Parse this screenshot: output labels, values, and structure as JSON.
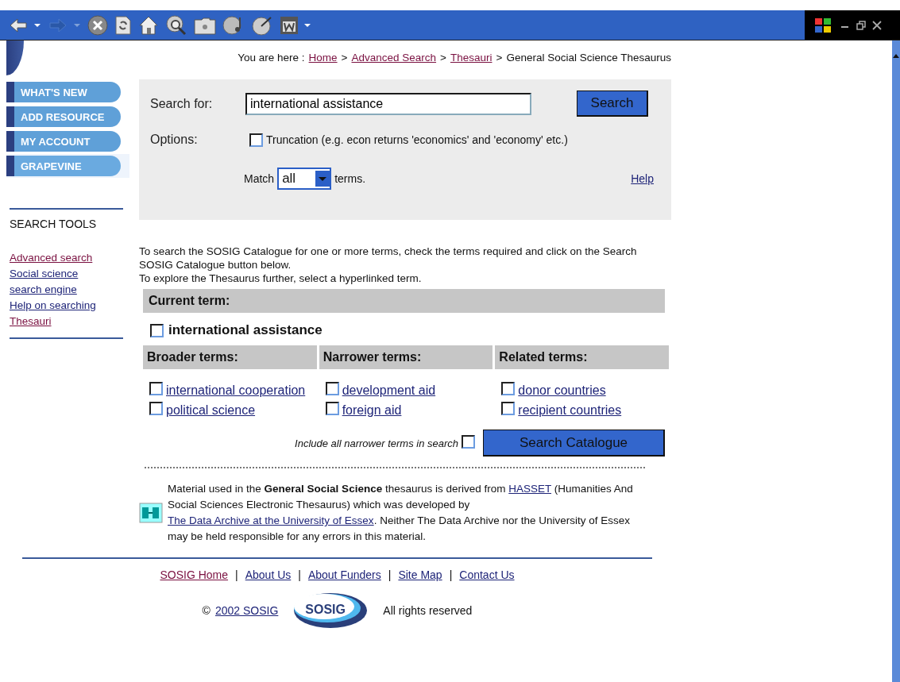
{
  "breadcrumb": {
    "label": "You are here :",
    "items": [
      {
        "kind": "link",
        "text": "Home",
        "visited": true
      },
      {
        "kind": "sep",
        "text": ">"
      },
      {
        "kind": "link",
        "text": "Advanced Search",
        "visited": true
      },
      {
        "kind": "sep",
        "text": ">"
      },
      {
        "kind": "link",
        "text": "Thesauri",
        "visited": true
      },
      {
        "kind": "sep",
        "text": ">"
      },
      {
        "kind": "text",
        "text": "General Social Science Thesaurus"
      }
    ]
  },
  "nav": [
    {
      "label": "WHAT'S NEW",
      "selected": false
    },
    {
      "label": "ADD RESOURCE",
      "selected": false
    },
    {
      "label": "MY ACCOUNT",
      "selected": false
    },
    {
      "label": "GRAPEVINE",
      "selected": true
    }
  ],
  "search_tools": {
    "heading": "SEARCH TOOLS",
    "links": [
      {
        "text": "Advanced search",
        "visited": true
      },
      {
        "text": "Social science search engine",
        "visited": false
      },
      {
        "text": "Help on searching",
        "visited": false
      },
      {
        "text": "Thesauri",
        "visited": true
      }
    ]
  },
  "search_form": {
    "search_label": "Search for:",
    "query": "international assistance",
    "search_button": "Search",
    "options_label": "Options:",
    "truncation": {
      "label": "Truncation (e.g. econ returns 'economics' and 'economy' etc.)",
      "checked": false
    },
    "match_label": "Match",
    "match_value": "all",
    "terms_label": "terms.",
    "help_link": "Help"
  },
  "instructions": [
    "To search the SOSIG Catalogue for one or more terms, check the terms required and click on the Search SOSIG Catalogue button below.",
    "To explore the Thesaurus further, select a hyperlinked term."
  ],
  "current_term": {
    "heading": "Current term:",
    "term": {
      "text": "international assistance",
      "checked": false
    }
  },
  "term_columns": [
    {
      "heading": "Broader terms:",
      "terms": [
        {
          "text": "international cooperation",
          "checked": false
        },
        {
          "text": "political science",
          "checked": false
        }
      ]
    },
    {
      "heading": "Narrower terms:",
      "terms": [
        {
          "text": "development aid",
          "checked": false
        },
        {
          "text": "foreign aid",
          "checked": false
        }
      ]
    },
    {
      "heading": "Related terms:",
      "terms": [
        {
          "text": "donor countries",
          "checked": false
        },
        {
          "text": "recipient countries",
          "checked": false
        }
      ]
    }
  ],
  "include_narrower": {
    "label": "Include all narrower terms in search",
    "checked": false
  },
  "search_catalogue_button": "Search Catalogue",
  "attribution": [
    {
      "kind": "text",
      "text": "Material used in the **General Social Science** thesaurus is derived from "
    },
    {
      "kind": "link",
      "text": "HASSET"
    },
    {
      "kind": "text",
      "text": " (Humanities And Social Sciences Electronic Thesaurus) which was developed by "
    },
    {
      "kind": "link",
      "text": "The Data Archive at the University of Essex"
    },
    {
      "kind": "text",
      "text": ". Neither The Data Archive nor the University of Essex may be held responsible for any errors in this material."
    }
  ],
  "footer_links": [
    {
      "kind": "link",
      "text": "SOSIG Home",
      "visited": true
    },
    {
      "kind": "sep",
      "text": "|"
    },
    {
      "kind": "link",
      "text": "About Us",
      "visited": false
    },
    {
      "kind": "sep",
      "text": "|"
    },
    {
      "kind": "link",
      "text": "About Funders",
      "visited": false
    },
    {
      "kind": "sep",
      "text": "|"
    },
    {
      "kind": "link",
      "text": "Site Map",
      "visited": false
    },
    {
      "kind": "sep",
      "text": "|"
    },
    {
      "kind": "link",
      "text": "Contact Us",
      "visited": false
    }
  ],
  "copyright": {
    "symbol": "©",
    "link": "2002 SOSIG",
    "logo_text": "SOSIG",
    "rights": "All rights reserved"
  }
}
